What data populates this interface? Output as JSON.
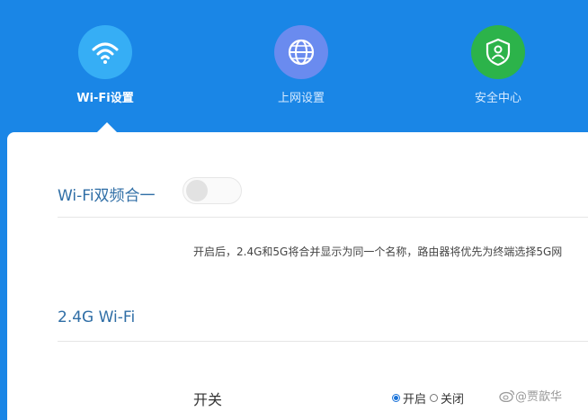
{
  "nav": {
    "items": [
      {
        "label": "Wi-Fi设置",
        "icon": "wifi-icon",
        "color": "#36aef5",
        "active": true
      },
      {
        "label": "上网设置",
        "icon": "globe-icon",
        "color": "#6a8bef",
        "active": false
      },
      {
        "label": "安全中心",
        "icon": "shield-user-icon",
        "color": "#2cb34a",
        "active": false
      }
    ]
  },
  "dual_band": {
    "title": "Wi-Fi双频合一",
    "enabled": false,
    "note": "开启后，2.4G和5G将合并显示为同一个名称，路由器将优先为终端选择5G网"
  },
  "wifi24": {
    "title": "2.4G Wi-Fi",
    "switch_label": "开关",
    "options": [
      {
        "label": "开启",
        "checked": true
      },
      {
        "label": "关闭",
        "checked": false
      }
    ]
  },
  "watermark": {
    "text": "@贾歆华",
    "icon": "weibo-icon"
  },
  "colors": {
    "header_bg": "#1a86e6",
    "title_blue": "#2f6ea6",
    "panel_bg": "#ffffff"
  }
}
